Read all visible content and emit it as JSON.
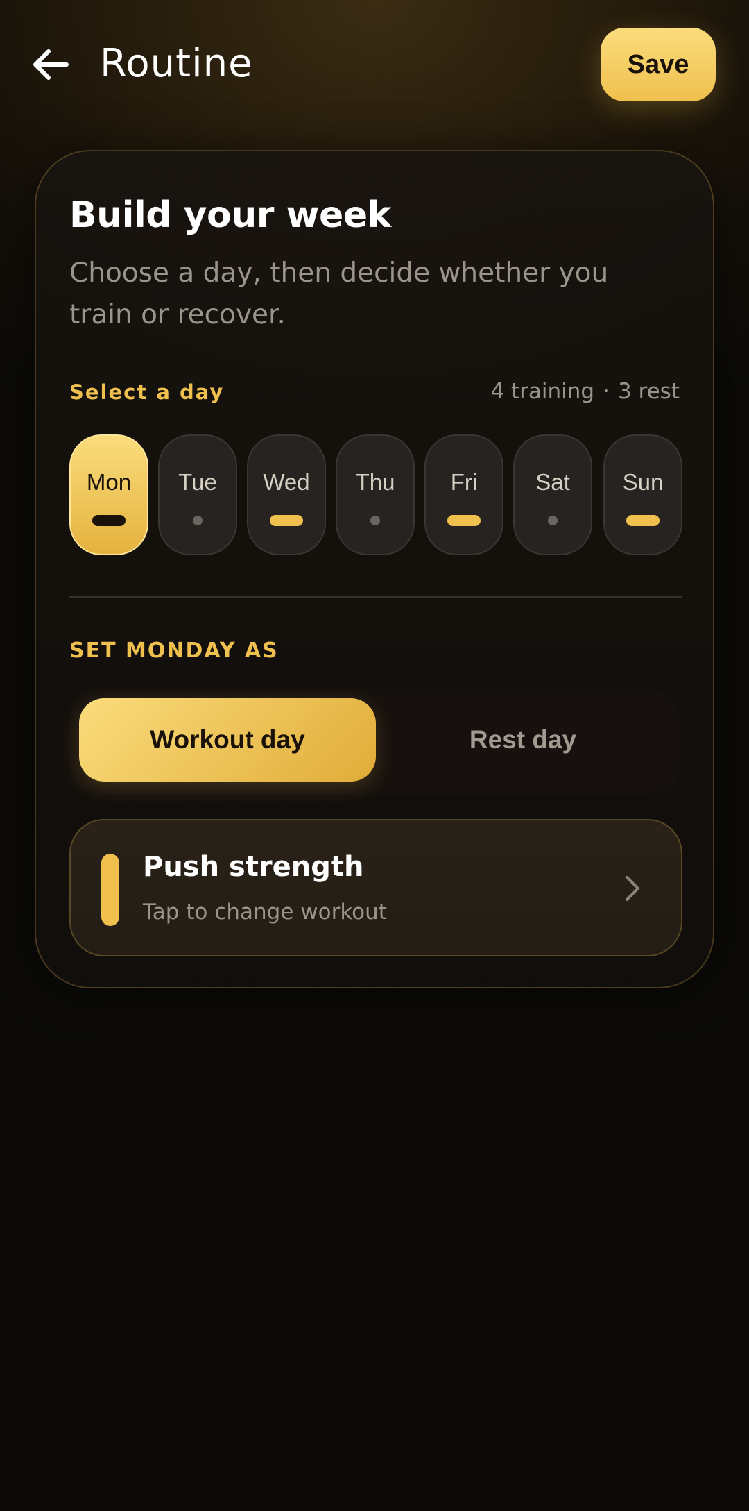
{
  "header": {
    "title": "Routine",
    "save_label": "Save",
    "back_icon": "arrow-left-icon"
  },
  "card": {
    "title": "Build your week",
    "subtitle": "Choose a day, then decide whether you train or recover.",
    "select_label": "Select a day",
    "summary": {
      "training": "4 training",
      "separator": "·",
      "rest": "3 rest"
    },
    "days": [
      {
        "label": "Mon",
        "type": "training",
        "selected": true
      },
      {
        "label": "Tue",
        "type": "rest",
        "selected": false
      },
      {
        "label": "Wed",
        "type": "training",
        "selected": false
      },
      {
        "label": "Thu",
        "type": "rest",
        "selected": false
      },
      {
        "label": "Fri",
        "type": "training",
        "selected": false
      },
      {
        "label": "Sat",
        "type": "rest",
        "selected": false
      },
      {
        "label": "Sun",
        "type": "training",
        "selected": false
      }
    ],
    "set_label": "SET MONDAY AS",
    "segment": {
      "workout_label": "Workout day",
      "rest_label": "Rest day",
      "selected": "workout"
    },
    "workout": {
      "name": "Push strength",
      "hint": "Tap to change workout",
      "chevron_icon": "chevron-right-icon"
    }
  },
  "colors": {
    "accent": "#f0c04e",
    "accent_light": "#fbdc7c",
    "muted_text": "#9a948a"
  }
}
